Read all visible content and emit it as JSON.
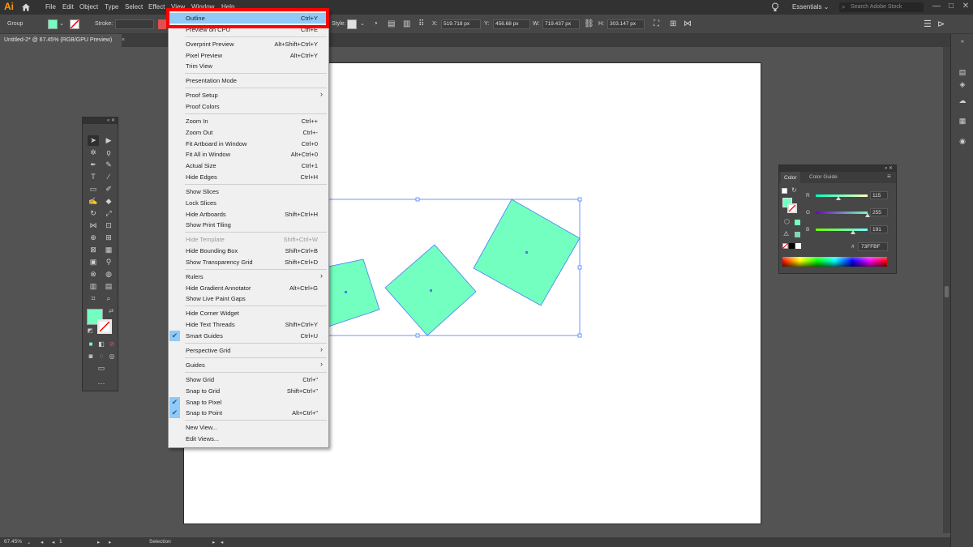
{
  "app": {
    "logo": "Ai",
    "menus": [
      "File",
      "Edit",
      "Object",
      "Type",
      "Select",
      "Effect",
      "View",
      "Window",
      "Help"
    ],
    "workspace": "Essentials",
    "search_placeholder": "Search Adobe Stock",
    "window_controls": [
      "—",
      "□",
      "✕"
    ]
  },
  "control_bar": {
    "selection_type": "Group",
    "stroke_label": "Stroke:",
    "style_label": "Style:",
    "x_label": "X:",
    "x_value": "519.718 px",
    "y_label": "Y:",
    "y_value": "456.68 px",
    "w_label": "W:",
    "w_value": "719.437 px",
    "h_label": "H:",
    "h_value": "303.147 px",
    "fill_color": "#73ffbf"
  },
  "document": {
    "tab_title": "Untitled-2* @ 67.45% (RGB/GPU Preview)",
    "tab_close": "×"
  },
  "view_menu": {
    "items": [
      {
        "label": "Outline",
        "shortcut": "Ctrl+Y",
        "highlight": true
      },
      {
        "label": "Preview on CPU",
        "shortcut": "Ctrl+E"
      },
      {
        "label": "Overprint Preview",
        "shortcut": "Alt+Shift+Ctrl+Y"
      },
      {
        "label": "Pixel Preview",
        "shortcut": "Alt+Ctrl+Y"
      },
      {
        "label": "Trim View",
        "shortcut": ""
      },
      {
        "label": "Presentation Mode",
        "shortcut": ""
      },
      {
        "label": "Proof Setup",
        "shortcut": "",
        "submenu": true
      },
      {
        "label": "Proof Colors",
        "shortcut": ""
      },
      {
        "label": "Zoom In",
        "shortcut": "Ctrl++"
      },
      {
        "label": "Zoom Out",
        "shortcut": "Ctrl+-"
      },
      {
        "label": "Fit Artboard in Window",
        "shortcut": "Ctrl+0"
      },
      {
        "label": "Fit All in Window",
        "shortcut": "Alt+Ctrl+0"
      },
      {
        "label": "Actual Size",
        "shortcut": "Ctrl+1"
      },
      {
        "label": "Hide Edges",
        "shortcut": "Ctrl+H"
      },
      {
        "label": "Show Slices",
        "shortcut": ""
      },
      {
        "label": "Lock Slices",
        "shortcut": ""
      },
      {
        "label": "Hide Artboards",
        "shortcut": "Shift+Ctrl+H"
      },
      {
        "label": "Show Print Tiling",
        "shortcut": ""
      },
      {
        "label": "Hide Template",
        "shortcut": "Shift+Ctrl+W",
        "disabled": true
      },
      {
        "label": "Hide Bounding Box",
        "shortcut": "Shift+Ctrl+B"
      },
      {
        "label": "Show Transparency Grid",
        "shortcut": "Shift+Ctrl+D"
      },
      {
        "label": "Rulers",
        "shortcut": "",
        "submenu": true
      },
      {
        "label": "Hide Gradient Annotator",
        "shortcut": "Alt+Ctrl+G"
      },
      {
        "label": "Show Live Paint Gaps",
        "shortcut": ""
      },
      {
        "label": "Hide Corner Widget",
        "shortcut": ""
      },
      {
        "label": "Hide Text Threads",
        "shortcut": "Shift+Ctrl+Y"
      },
      {
        "label": "Smart Guides",
        "shortcut": "Ctrl+U",
        "checked": true
      },
      {
        "label": "Perspective Grid",
        "shortcut": "",
        "submenu": true
      },
      {
        "label": "Guides",
        "shortcut": "",
        "submenu": true
      },
      {
        "label": "Show Grid",
        "shortcut": "Ctrl+\""
      },
      {
        "label": "Snap to Grid",
        "shortcut": "Shift+Ctrl+\""
      },
      {
        "label": "Snap to Pixel",
        "shortcut": "",
        "checked": true
      },
      {
        "label": "Snap to Point",
        "shortcut": "Alt+Ctrl+\"",
        "checked": true
      },
      {
        "label": "New View...",
        "shortcut": ""
      },
      {
        "label": "Edit Views...",
        "shortcut": ""
      }
    ],
    "submenu_arrow": "›",
    "check_mark": "✔"
  },
  "color_panel": {
    "tabs": [
      "Color",
      "Color Guide"
    ],
    "r_label": "R",
    "r_value": "115",
    "g_label": "G",
    "g_value": "255",
    "b_label": "B",
    "b_value": "191",
    "hex_prefix": "#",
    "hex_value": "73FFBF",
    "current_color": "#73ffbf"
  },
  "status_bar": {
    "zoom": "67.45%",
    "artboard_number": "1",
    "tool_name": "Selection"
  },
  "shape_fill": "#73ffbf",
  "selection_color": "#4a7dff"
}
